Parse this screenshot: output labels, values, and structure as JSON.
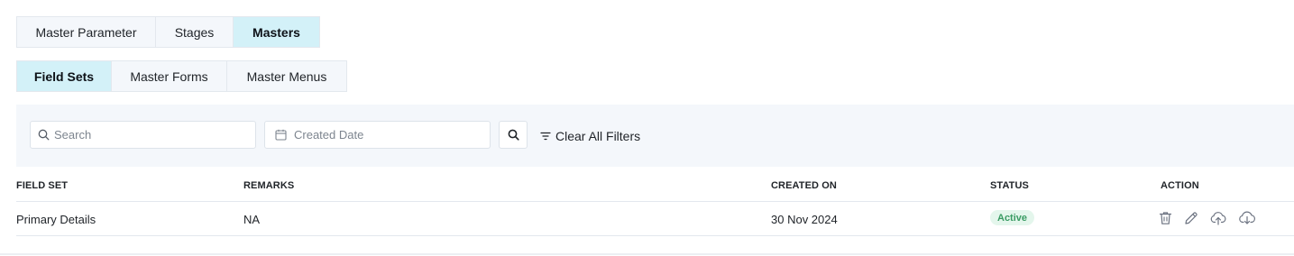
{
  "top_tabs": [
    {
      "label": "Master Parameter",
      "active": false
    },
    {
      "label": "Stages",
      "active": false
    },
    {
      "label": "Masters",
      "active": true
    }
  ],
  "sub_tabs": [
    {
      "label": "Field Sets",
      "active": true
    },
    {
      "label": "Master Forms",
      "active": false
    },
    {
      "label": "Master Menus",
      "active": false
    }
  ],
  "filters": {
    "search_placeholder": "Search",
    "date_placeholder": "Created Date",
    "clear_label": "Clear All Filters"
  },
  "table": {
    "columns": [
      "FIELD SET",
      "REMARKS",
      "CREATED ON",
      "STATUS",
      "ACTION"
    ],
    "rows": [
      {
        "field_set": "Primary Details",
        "remarks": "NA",
        "created_on": "30 Nov 2024",
        "status": "Active",
        "actions": [
          "trash-icon",
          "edit-pencil-icon",
          "upload-icon",
          "cloud-download-icon"
        ]
      }
    ]
  },
  "colors": {
    "active_tab_bg": "#d3f1f8",
    "tab_bg": "#f4f7fb",
    "filter_bar_bg": "#f4f7fb",
    "status_active_bg": "#e4f6ec",
    "status_active_text": "#3a9b63"
  }
}
